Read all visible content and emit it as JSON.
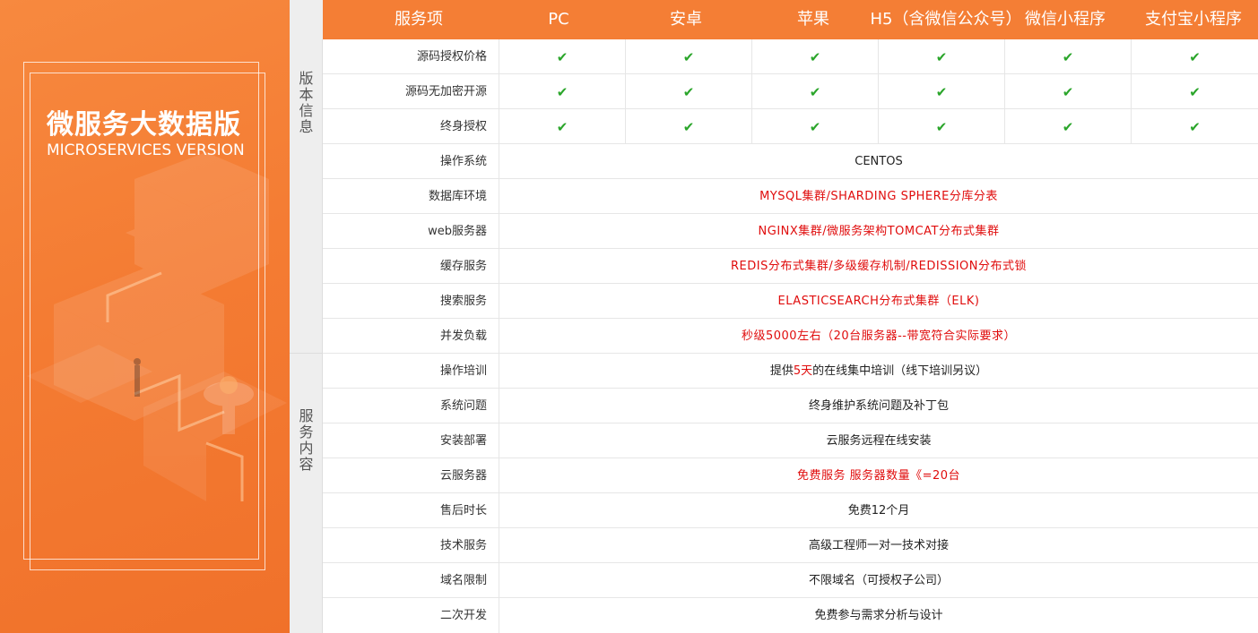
{
  "left_panel": {
    "title": "微服务大数据版",
    "subtitle": "MICROSERVICES VERSION"
  },
  "categories": {
    "version_info": [
      "版",
      "本",
      "信",
      "息"
    ],
    "service_content": [
      "服",
      "务",
      "内",
      "容"
    ]
  },
  "header": {
    "item_label": "服务项",
    "platforms": [
      "PC",
      "安卓",
      "苹果",
      "H5（含微信公众号）",
      "微信小程序",
      "支付宝小程序"
    ]
  },
  "check_rows": [
    {
      "label": "源码授权价格"
    },
    {
      "label": "源码无加密开源"
    },
    {
      "label": "终身授权"
    }
  ],
  "check_mark": "✔",
  "span_rows": [
    {
      "label": "操作系统",
      "value": "CENTOS",
      "red": false
    },
    {
      "label": "数据库环境",
      "value": "MYSQL集群/SHARDING SPHERE分库分表",
      "red": true
    },
    {
      "label": "web服务器",
      "value": "NGINX集群/微服务架构TOMCAT分布式集群",
      "red": true
    },
    {
      "label": "缓存服务",
      "value": "REDIS分布式集群/多级缓存机制/REDISSION分布式锁",
      "red": true
    },
    {
      "label": "搜索服务",
      "value": "ELASTICSEARCH分布式集群（ELK)",
      "red": true
    },
    {
      "label": "并发负载",
      "value": "秒级5000左右（20台服务器--带宽符合实际要求）",
      "red": true
    }
  ],
  "training_row": {
    "label": "操作培训",
    "prefix": "提供",
    "highlight": "5天",
    "suffix": "的在线集中培训（线下培训另议）"
  },
  "service_rows": [
    {
      "label": "系统问题",
      "value": "终身维护系统问题及补丁包",
      "red": false
    },
    {
      "label": "安装部署",
      "value": "云服务远程在线安装",
      "red": false
    },
    {
      "label": "云服务器",
      "value": "免费服务 服务器数量《=20台",
      "red": true
    },
    {
      "label": "售后时长",
      "value": "免费12个月",
      "red": false
    },
    {
      "label": "技术服务",
      "value": "高级工程师一对一技术对接",
      "red": false
    },
    {
      "label": "域名限制",
      "value": "不限域名（可授权子公司）",
      "red": false
    },
    {
      "label": "二次开发",
      "value": "免费参与需求分析与设计",
      "red": false
    }
  ],
  "colors": {
    "brand_orange": "#f47e35",
    "check_green": "#2aa52a",
    "highlight_red": "#e00d0d"
  }
}
